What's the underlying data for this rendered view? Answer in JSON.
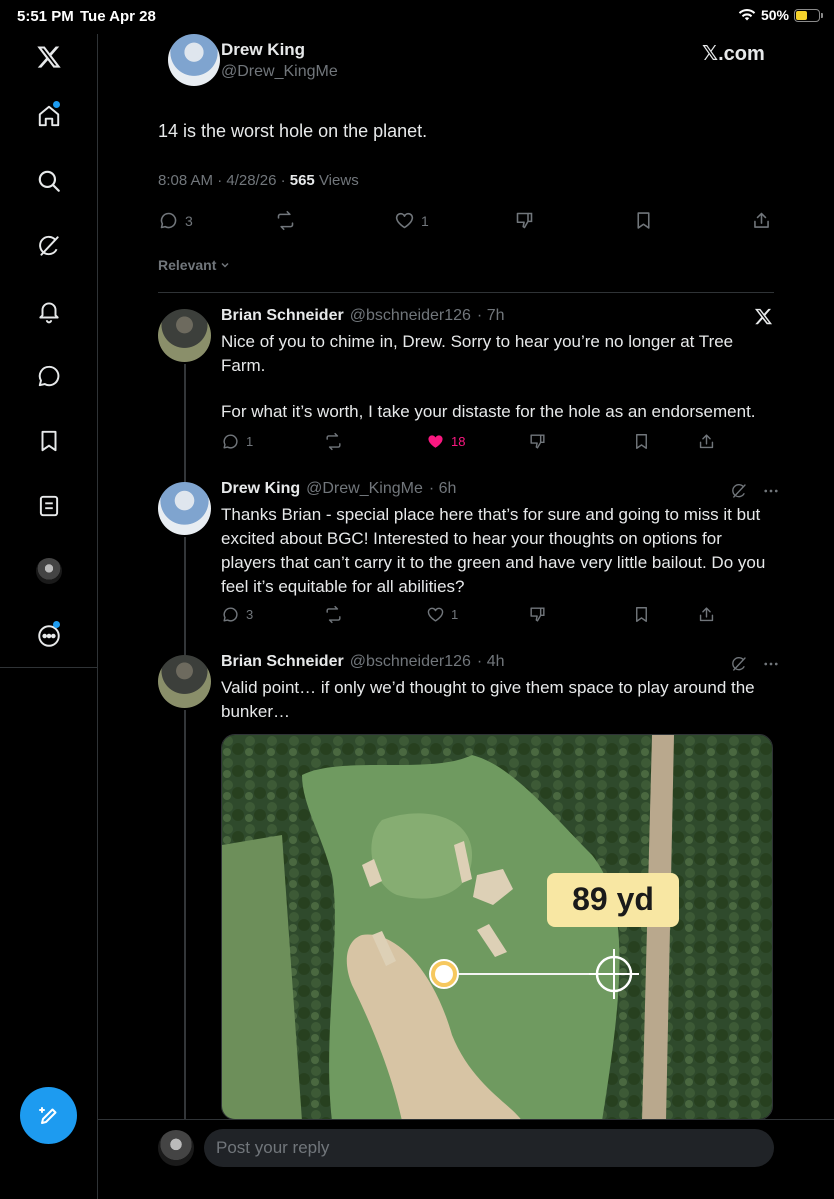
{
  "status_bar": {
    "time": "5:51 PM",
    "date": "Tue Apr 28",
    "battery": "50%",
    "battery_level": 0.5
  },
  "brand": {
    "site": "𝕏.com"
  },
  "nav": [
    {
      "name": "x-logo-icon"
    },
    {
      "name": "home-icon",
      "badge": true
    },
    {
      "name": "search-icon"
    },
    {
      "name": "grok-icon"
    },
    {
      "name": "notifications-icon"
    },
    {
      "name": "messages-icon"
    },
    {
      "name": "bookmarks-icon"
    },
    {
      "name": "lists-icon"
    },
    {
      "name": "profile-avatar"
    },
    {
      "name": "more-icon",
      "badge": true
    }
  ],
  "main_tweet": {
    "author_name": "Drew King",
    "author_handle": "@Drew_KingMe",
    "text": "14 is the worst hole on the planet.",
    "time": "8:08 AM · 4/28/26 · ",
    "views_count": "565",
    "views_label": " Views",
    "replies": "3",
    "reposts": "",
    "likes": "1"
  },
  "sort": {
    "label": "Relevant"
  },
  "replies": [
    {
      "author_name": "Brian Schneider",
      "author_handle": "@bschneider126",
      "age": "· 7h",
      "text_1": "Nice of you to chime in, Drew. Sorry to hear you’re no longer at Tree Farm.",
      "text_2": "For what it’s worth, I take your distaste for the hole as an endorsement.",
      "replies": "1",
      "likes": "18"
    },
    {
      "author_name": "Drew King",
      "author_handle": "@Drew_KingMe",
      "age": "· 6h",
      "text": "Thanks Brian - special place here that’s for sure and going to miss it but excited about BGC! Interested to hear your thoughts on options for players that can’t carry it to the green and have very little bailout. Do you feel it’s equitable for all abilities?",
      "replies": "3",
      "likes": "1"
    },
    {
      "author_name": "Brian Schneider",
      "author_handle": "@bschneider126",
      "age": "· 4h",
      "text": "Valid point… if only we’d thought to give them space to play around the bunker…",
      "image_label": "89 yd"
    }
  ],
  "reply_box": {
    "placeholder": "Post your reply"
  },
  "colors": {
    "accent": "#1d9bf0",
    "like": "#f91880",
    "muted": "#71767b",
    "text": "#e7e9ea"
  }
}
